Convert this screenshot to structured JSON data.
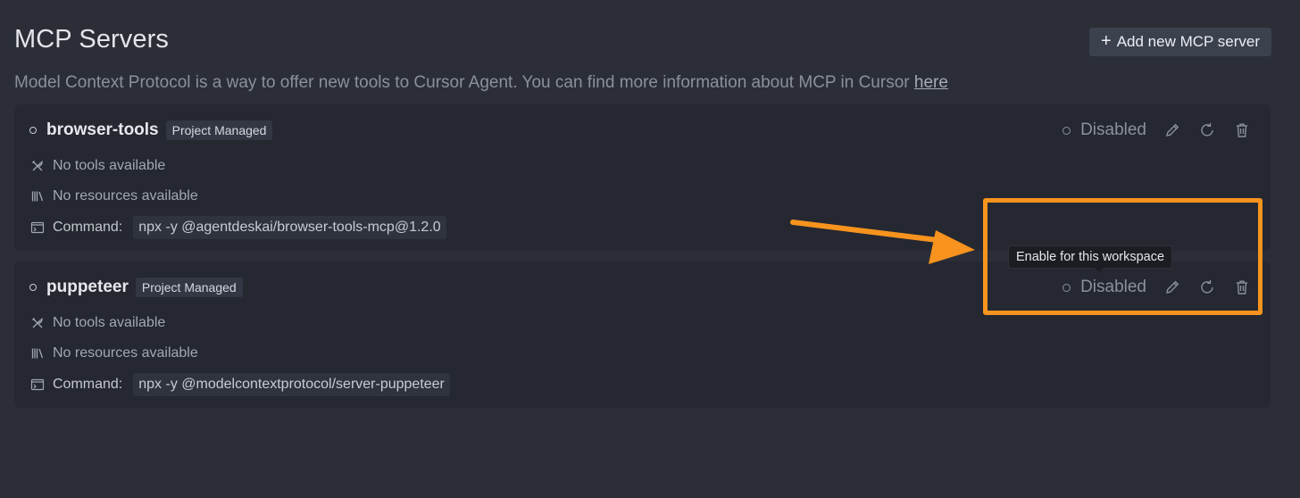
{
  "header": {
    "title": "MCP Servers",
    "description": "Model Context Protocol is a way to offer new tools to Cursor Agent. You can find more information about MCP in Cursor ",
    "link_text": "here",
    "add_button_label": "Add new MCP server",
    "add_button_icon": "plus-icon"
  },
  "servers": [
    {
      "name": "browser-tools",
      "badge": "Project Managed",
      "tools_text": "No tools available",
      "resources_text": "No resources available",
      "command_label": "Command:",
      "command": "npx -y @agentdeskai/browser-tools-mcp@1.2.0",
      "status": "Disabled"
    },
    {
      "name": "puppeteer",
      "badge": "Project Managed",
      "tools_text": "No tools available",
      "resources_text": "No resources available",
      "command_label": "Command:",
      "command": "npx -y @modelcontextprotocol/server-puppeteer",
      "status": "Disabled"
    }
  ],
  "tooltip": {
    "text": "Enable for this workspace"
  },
  "annotation": {
    "color": "#f7931e"
  },
  "colors": {
    "background": "#2b2e37",
    "card": "#252831",
    "button": "#3c414e"
  }
}
